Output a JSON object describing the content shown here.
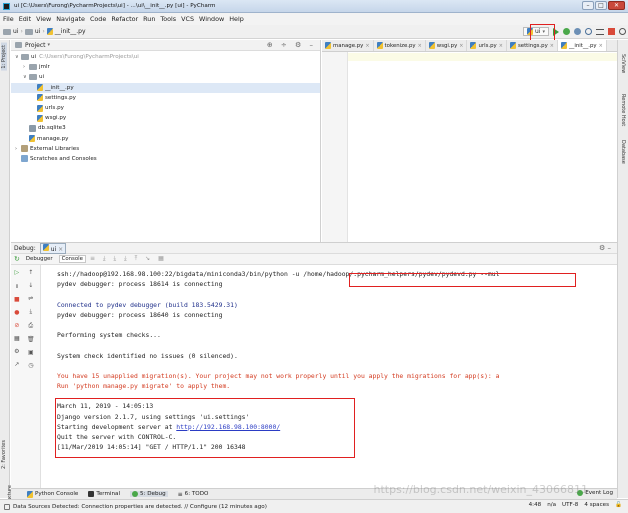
{
  "window": {
    "title": "ui [C:\\Users\\Furong\\PycharmProjects\\ui] - ...\\ui\\__init__.py [ui] - PyCharm",
    "buttons": [
      "–",
      "□",
      "✕"
    ]
  },
  "menu": [
    "File",
    "Edit",
    "View",
    "Navigate",
    "Code",
    "Refactor",
    "Run",
    "Tools",
    "VCS",
    "Window",
    "Help"
  ],
  "navbar": {
    "crumbs": [
      "ui",
      "ui",
      "__init__.py"
    ],
    "run_config": "ui"
  },
  "project_panel": {
    "title": "Project",
    "root_name": "ui",
    "root_path": "C:\\Users\\Furong\\PycharmProjects\\ui",
    "items": [
      {
        "label": "jmlr"
      },
      {
        "label": "ui"
      },
      {
        "label": "__init__.py"
      },
      {
        "label": "settings.py"
      },
      {
        "label": "urls.py"
      },
      {
        "label": "wsgi.py"
      },
      {
        "label": "db.sqlite3"
      },
      {
        "label": "manage.py"
      },
      {
        "label": "External Libraries"
      },
      {
        "label": "Scratches and Consoles"
      }
    ]
  },
  "editor": {
    "tabs": [
      {
        "label": "manage.py"
      },
      {
        "label": "tokenize.py"
      },
      {
        "label": "wsgi.py"
      },
      {
        "label": "urls.py"
      },
      {
        "label": "settings.py"
      },
      {
        "label": "__init__.py"
      }
    ]
  },
  "right_tabs": [
    "SciView",
    "Remote Host",
    "Database"
  ],
  "left_tabs": [
    "1: Project",
    "2: Favorites",
    "7: Structure"
  ],
  "debug": {
    "title": "Debug:",
    "config_tab": "ui",
    "tabs": [
      "Debugger",
      "Console"
    ],
    "console_lines": [
      {
        "text": "ssh://hadoop@192.168.98.100:22/bigdata/miniconda3/bin/python -u /home/hadoop/.pycharm_helpers/pydev/pydevd.py --mul",
        "style": "c-dark"
      },
      {
        "text": "pydev debugger: process 18614 is connecting",
        "style": "c-dark"
      },
      {
        "text": "",
        "style": "c-dark"
      },
      {
        "text": "Connected to pydev debugger (build 183.5429.31)",
        "style": "c-blue"
      },
      {
        "text": "pydev debugger: process 18640 is connecting",
        "style": "c-dark"
      },
      {
        "text": "",
        "style": "c-dark"
      },
      {
        "text": "Performing system checks...",
        "style": "c-dark"
      },
      {
        "text": "",
        "style": "c-dark"
      },
      {
        "text": "System check identified no issues (0 silenced).",
        "style": "c-dark"
      },
      {
        "text": "",
        "style": "c-dark"
      },
      {
        "text": "You have 15 unapplied migration(s). Your project may not work properly until you apply the migrations for app(s): a",
        "style": "c-red"
      },
      {
        "text": "Run 'python manage.py migrate' to apply them.",
        "style": "c-red"
      },
      {
        "text": "",
        "style": "c-dark"
      },
      {
        "text": "March 11, 2019 - 14:05:13",
        "style": "c-dark"
      },
      {
        "text": "Django version 2.1.7, using settings 'ui.settings'",
        "style": "c-dark"
      },
      {
        "text": "Starting development server at ",
        "link": "http://192.168.98.100:8000/",
        "style": "c-dark"
      },
      {
        "text": "Quit the server with CONTROL-C.",
        "style": "c-dark"
      },
      {
        "text": "[11/Mar/2019 14:05:14] \"GET / HTTP/1.1\" 200 16348",
        "style": "c-dark"
      }
    ]
  },
  "bottom_tabs": [
    "Python Console",
    "Terminal",
    "5: Debug",
    "6: TODO"
  ],
  "event_log": "Event Log",
  "status": {
    "message": "Data Sources Detected: Connection properties are detected. // Configure (12 minutes ago)",
    "position": "4:48",
    "line_sep": "n/a",
    "encoding": "UTF-8",
    "indent": "4 spaces"
  },
  "watermark": "https://blog.csdn.net/weixin_43066811",
  "colors": {
    "highlight": "#e02020",
    "console_blue": "#1f2f8a",
    "console_red": "#d33a1f"
  }
}
